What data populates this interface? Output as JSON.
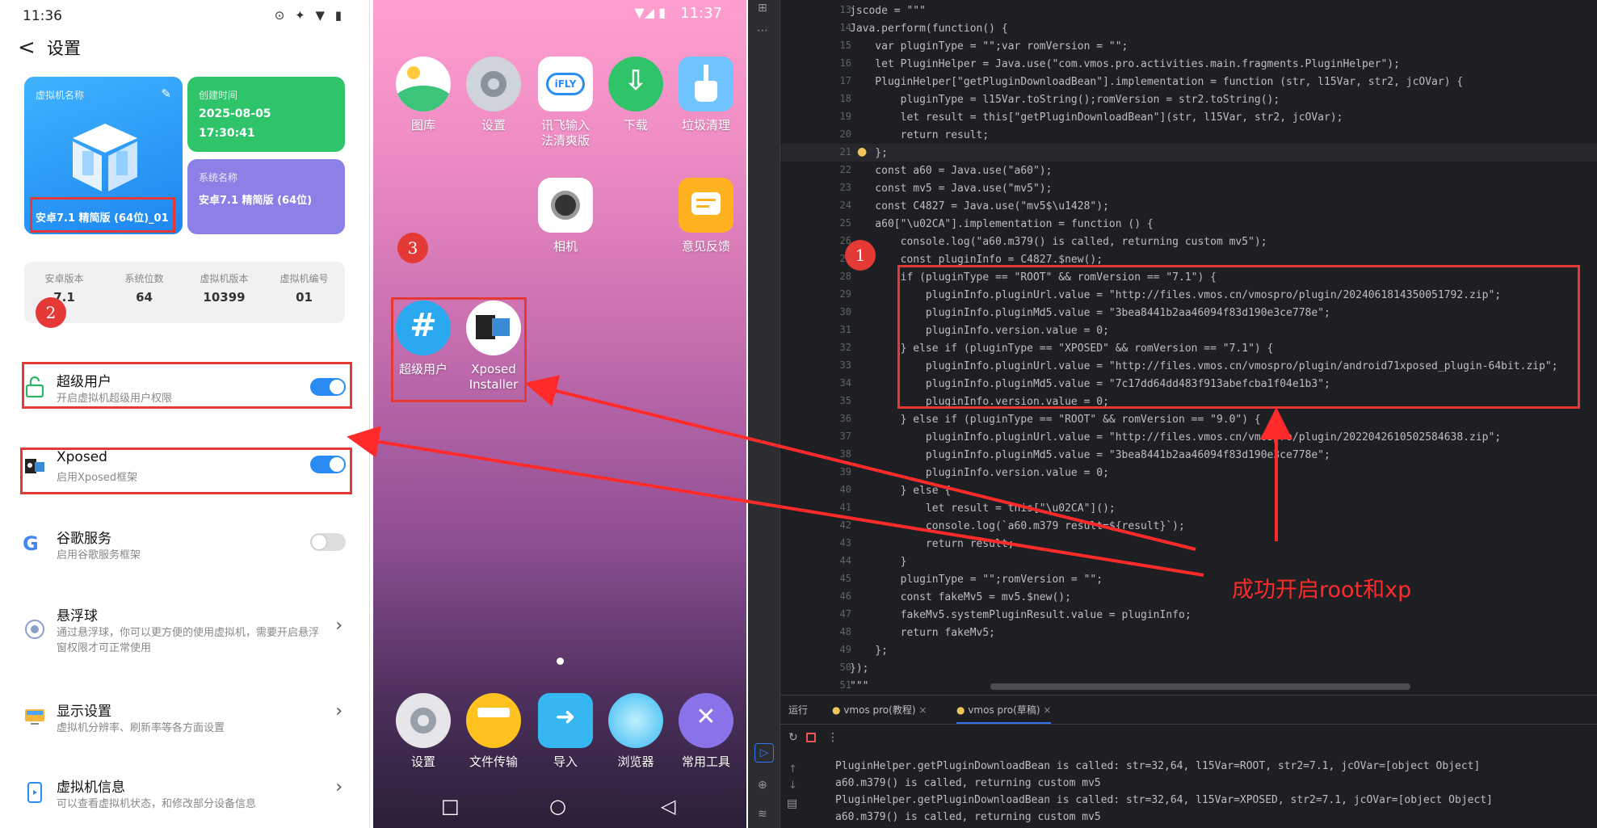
{
  "settings": {
    "status_time": "11:36",
    "back": "<",
    "title": "设置",
    "vm_name_label": "虚拟机名称",
    "vm_name_value": "安卓7.1 精简版 (64位)_01",
    "create_time_label": "创建时间",
    "create_date": "2025-08-05",
    "create_clock": "17:30:41",
    "system_name_label": "系统名称",
    "system_name_value": "安卓7.1 精简版 (64位)",
    "info": [
      {
        "k": "安卓版本",
        "v": "7.1"
      },
      {
        "k": "系统位数",
        "v": "64"
      },
      {
        "k": "虚拟机版本",
        "v": "10399"
      },
      {
        "k": "虚拟机编号",
        "v": "01"
      }
    ],
    "rows": [
      {
        "title": "超级用户",
        "sub": "开启虚拟机超级用户权限",
        "toggle": true
      },
      {
        "title": "Xposed",
        "sub": "启用Xposed框架",
        "toggle": true
      },
      {
        "title": "谷歌服务",
        "sub": "启用谷歌服务框架",
        "toggle": false
      },
      {
        "title": "悬浮球",
        "sub": "通过悬浮球，你可以更方便的使用虚拟机，需要开启悬浮窗权限才可正常使用"
      },
      {
        "title": "显示设置",
        "sub": "虚拟机分辨率、刷新率等各方面设置"
      },
      {
        "title": "虚拟机信息",
        "sub": "可以查看虚拟机状态，和修改部分设备信息"
      }
    ]
  },
  "home": {
    "status_time": "11:37",
    "apps_row1": [
      "图库",
      "设置",
      "讯飞输入法清爽版",
      "下载",
      "垃圾清理"
    ],
    "ifly_label_l1": "讯飞输入",
    "ifly_label_l2": "法清爽版",
    "apps_row2": [
      "相机",
      "意见反馈"
    ],
    "apps_row3": [
      "超级用户"
    ],
    "xposed_l1": "Xposed",
    "xposed_l2": "Installer",
    "dock": [
      "设置",
      "文件传输",
      "导入",
      "浏览器",
      "常用工具"
    ]
  },
  "badges": [
    "1",
    "2",
    "3"
  ],
  "ide": {
    "code_lines": [
      {
        "n": "13",
        "t": "jscode = \"\"\""
      },
      {
        "n": "14",
        "t": "Java.perform(function() {"
      },
      {
        "n": "15",
        "t": "    var pluginType = \"\";var romVersion = \"\";"
      },
      {
        "n": "16",
        "t": "    let PluginHelper = Java.use(\"com.vmos.pro.activities.main.fragments.PluginHelper\");"
      },
      {
        "n": "17",
        "t": "    PluginHelper[\"getPluginDownloadBean\"].implementation = function (str, l15Var, str2, jcOVar) {"
      },
      {
        "n": "18",
        "t": "        pluginType = l15Var.toString();romVersion = str2.toString();"
      },
      {
        "n": "19",
        "t": "        let result = this[\"getPluginDownloadBean\"](str, l15Var, str2, jcOVar);"
      },
      {
        "n": "20",
        "t": "        return result;"
      },
      {
        "n": "21",
        "t": "    };"
      },
      {
        "n": "22",
        "t": "    const a60 = Java.use(\"a60\");"
      },
      {
        "n": "23",
        "t": "    const mv5 = Java.use(\"mv5\");"
      },
      {
        "n": "24",
        "t": "    const C4827 = Java.use(\"mv5$\\u1428\");"
      },
      {
        "n": "25",
        "t": "    a60[\"\\u02CA\"].implementation = function () {"
      },
      {
        "n": "26",
        "t": "        console.log(\"a60.m379() is called, returning custom mv5\");"
      },
      {
        "n": "27",
        "t": "        const pluginInfo = C4827.$new();"
      },
      {
        "n": "28",
        "t": "        if (pluginType == \"ROOT\" && romVersion == \"7.1\") {"
      },
      {
        "n": "29",
        "t": "            pluginInfo.pluginUrl.value = \"http://files.vmos.cn/vmospro/plugin/2024061814350051792.zip\";"
      },
      {
        "n": "30",
        "t": "            pluginInfo.pluginMd5.value = \"3bea8441b2aa46094f83d190e3ce778e\";"
      },
      {
        "n": "31",
        "t": "            pluginInfo.version.value = 0;"
      },
      {
        "n": "32",
        "t": "        } else if (pluginType == \"XPOSED\" && romVersion == \"7.1\") {"
      },
      {
        "n": "33",
        "t": "            pluginInfo.pluginUrl.value = \"http://files.vmos.cn/vmospro/plugin/android71xposed_plugin-64bit.zip\";"
      },
      {
        "n": "34",
        "t": "            pluginInfo.pluginMd5.value = \"7c17dd64dd483f913abefcba1f04e1b3\";"
      },
      {
        "n": "35",
        "t": "            pluginInfo.version.value = 0;"
      },
      {
        "n": "36",
        "t": "        } else if (pluginType == \"ROOT\" && romVersion == \"9.0\") {"
      },
      {
        "n": "37",
        "t": "            pluginInfo.pluginUrl.value = \"http://files.vmos.cn/vmospro/plugin/2022042610502584638.zip\";"
      },
      {
        "n": "38",
        "t": "            pluginInfo.pluginMd5.value = \"3bea8441b2aa46094f83d190e3ce778e\";"
      },
      {
        "n": "39",
        "t": "            pluginInfo.version.value = 0;"
      },
      {
        "n": "40",
        "t": "        } else {"
      },
      {
        "n": "41",
        "t": "            let result = this[\"\\u02CA\"]();"
      },
      {
        "n": "42",
        "t": "            console.log(`a60.m379 result=${result}`);"
      },
      {
        "n": "43",
        "t": "            return result;"
      },
      {
        "n": "44",
        "t": "        }"
      },
      {
        "n": "45",
        "t": "        pluginType = \"\";romVersion = \"\";"
      },
      {
        "n": "46",
        "t": "        const fakeMv5 = mv5.$new();"
      },
      {
        "n": "47",
        "t": "        fakeMv5.systemPluginResult.value = pluginInfo;"
      },
      {
        "n": "48",
        "t": "        return fakeMv5;"
      },
      {
        "n": "49",
        "t": "    };"
      },
      {
        "n": "50",
        "t": "});"
      },
      {
        "n": "51",
        "t": "\"\"\""
      }
    ],
    "run_label": "运行",
    "tab1": "vmos pro(教程)",
    "tab2": "vmos pro(草稿)",
    "tab_close": "×",
    "output": [
      "PluginHelper.getPluginDownloadBean is called: str=32,64, l15Var=ROOT, str2=7.1, jcOVar=[object Object]",
      "a60.m379() is called, returning custom mv5",
      "PluginHelper.getPluginDownloadBean is called: str=32,64, l15Var=XPOSED, str2=7.1, jcOVar=[object Object]",
      "a60.m379() is called, returning custom mv5"
    ],
    "annotation": "成功开启root和xp"
  },
  "colors": {
    "annotation_red": "#e53935",
    "toggle_on": "#2a8cf3"
  }
}
